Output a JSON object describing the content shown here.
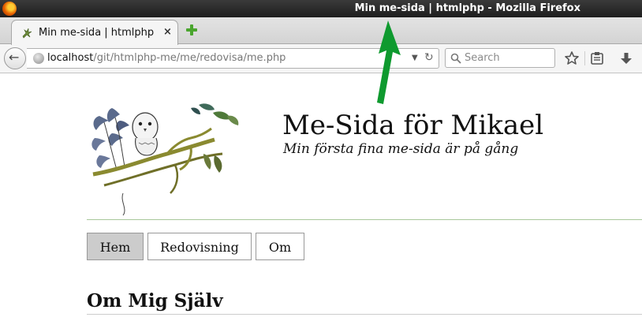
{
  "window": {
    "title": "Min me-sida | htmlphp - Mozilla Firefox"
  },
  "tabs": [
    {
      "label": "Min me-sida | htmlphp",
      "close_glyph": "×",
      "icon": "lizard-favicon"
    }
  ],
  "navbar": {
    "url_host": "localhost",
    "url_path": "/git/htmlphp-me/me/redovisa/me.php",
    "search_placeholder": "Search"
  },
  "site": {
    "title": "Me-Sida för Mikael",
    "slogan": "Min första fina me-sida är på gång"
  },
  "menu": {
    "items": [
      {
        "label": "Hem",
        "active": true
      },
      {
        "label": "Redovisning",
        "active": false
      },
      {
        "label": "Om",
        "active": false
      }
    ]
  },
  "content": {
    "heading": "Om Mig Själv"
  },
  "colors": {
    "titlebar": "#1e1e1e",
    "annotation_arrow": "#0f9a2f",
    "active_menu_bg": "#cccccc",
    "header_line": "#a8c89a"
  }
}
